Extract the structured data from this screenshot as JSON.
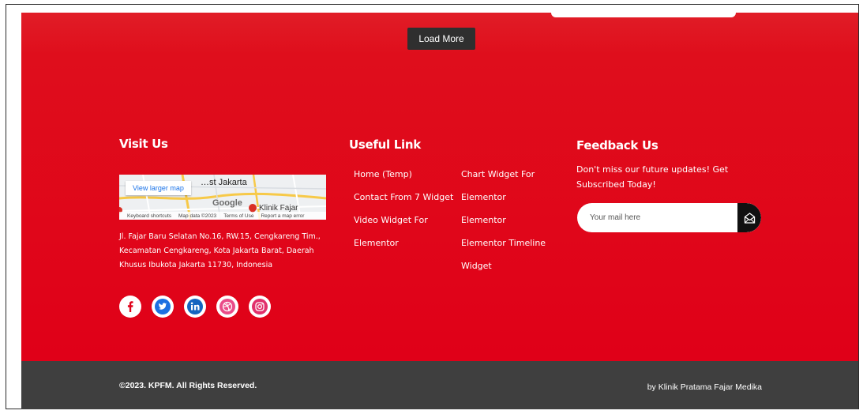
{
  "load_more": {
    "label": "Load More"
  },
  "visit": {
    "heading": "Visit Us",
    "map": {
      "button": "View larger map",
      "place": "…st Jakarta",
      "google": "Google",
      "pin_label": "Klinik Fajar",
      "footer_items": [
        "Keyboard shortcuts",
        "Map data ©2023",
        "Terms of Use",
        "Report a map error"
      ]
    },
    "address": "Jl. Fajar Baru Selatan No.16, RW.15, Cengkareng Tim., Kecamatan Cengkareng, Kota Jakarta Barat, Daerah Khusus Ibukota Jakarta 11730, Indonesia",
    "social": [
      "facebook-icon",
      "twitter-icon",
      "linkedin-icon",
      "dribbble-icon",
      "instagram-icon"
    ]
  },
  "useful": {
    "heading": "Useful Link",
    "col1": [
      "Home (Temp)",
      "Contact From 7 Widget",
      "Video Widget For",
      "Elementor"
    ],
    "col2": [
      "Chart Widget For",
      "Elementor",
      "Elementor",
      "Elementor Timeline",
      "Widget"
    ]
  },
  "feedback": {
    "heading": "Feedback Us",
    "text": "Don't miss our future updates! Get Subscribed Today!",
    "placeholder": "Your mail here",
    "send_icon": "envelope-icon"
  },
  "footer": {
    "copyright": "©2023. KPFM. All Rights Reserved.",
    "by": "by Klinik Pratama Fajar Medika"
  },
  "colors": {
    "red": "#e00018",
    "dark": "#3f3f3f",
    "button": "#2f2f2f"
  }
}
